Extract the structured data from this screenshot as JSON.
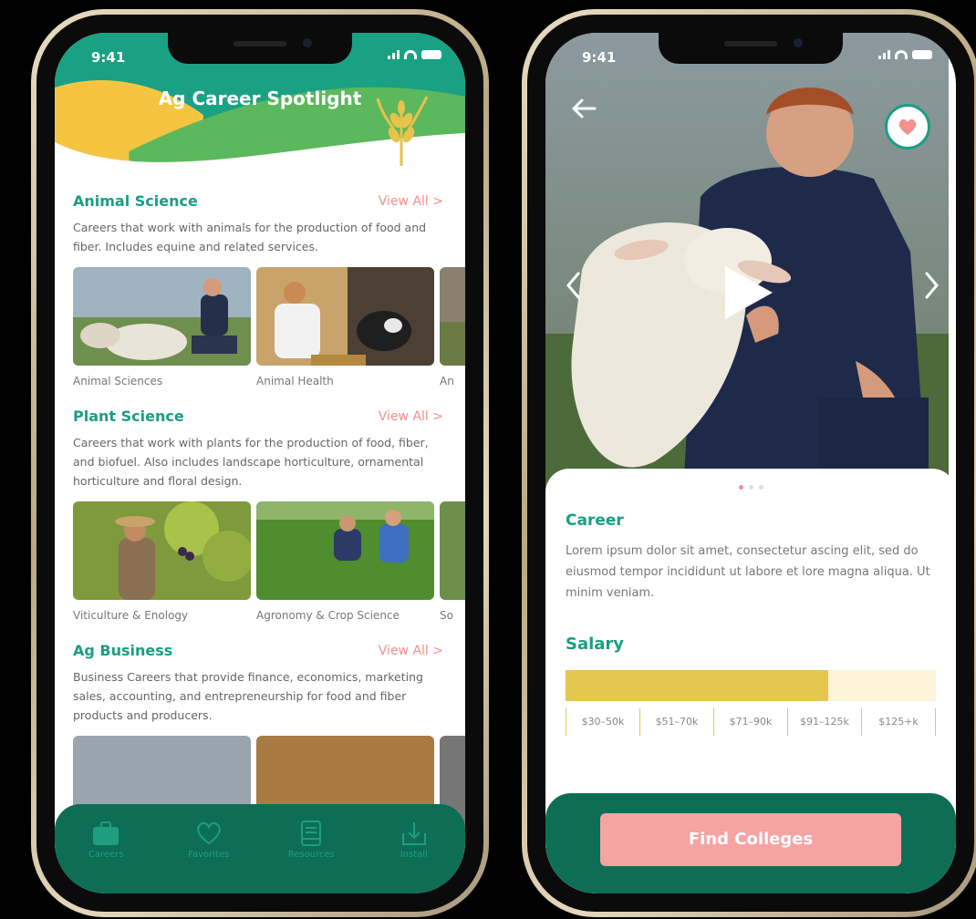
{
  "status_bar": {
    "time": "9:41"
  },
  "left_screen": {
    "title": "Ag Career Spotlight",
    "sections": [
      {
        "title": "Animal Science",
        "view_all": "View All >",
        "description": "Careers that work with animals for the production of food and fiber. Includes equine and related services.",
        "items": [
          "Animal Sciences",
          "Animal Health",
          "An"
        ]
      },
      {
        "title": "Plant Science",
        "view_all": "View All >",
        "description": "Careers that work with plants for the production of food, fiber, and biofuel. Also includes landscape horticulture, ornamental horticulture and floral design.",
        "items": [
          "Viticulture & Enology",
          "Agronomy & Crop Science",
          "So"
        ]
      },
      {
        "title": "Ag Business",
        "view_all": "View All >",
        "description": "Business Careers that provide finance, economics, marketing sales, accounting, and entrepreneurship for food and fiber products and producers.",
        "items": []
      }
    ],
    "tabs": [
      {
        "label": "Careers",
        "icon": "briefcase-icon",
        "active": true
      },
      {
        "label": "Favorites",
        "icon": "heart-icon",
        "active": false
      },
      {
        "label": "Resources",
        "icon": "book-icon",
        "active": false
      },
      {
        "label": "Install",
        "icon": "download-icon",
        "active": false
      }
    ]
  },
  "right_screen": {
    "career_heading": "Career",
    "career_text": "Lorem ipsum dolor sit amet, consectetur ascing elit, sed do eiusmod tempor incididunt ut labore et lore magna aliqua. Ut minim veniam.",
    "salary_heading": "Salary",
    "salary_fill_fraction": 0.71,
    "salary_ranges": [
      "$30–50k",
      "$51–70k",
      "$71–90k",
      "$91–125k",
      "$125+k"
    ],
    "carousel": {
      "total": 3,
      "active_index": 0
    },
    "cta_label": "Find Colleges"
  },
  "colors": {
    "brand_green": "#1a9e84",
    "dark_green": "#0d6e55",
    "accent_pink": "#f4908e",
    "salary_yellow": "#e5c64f",
    "header_yellow": "#f5c542"
  }
}
